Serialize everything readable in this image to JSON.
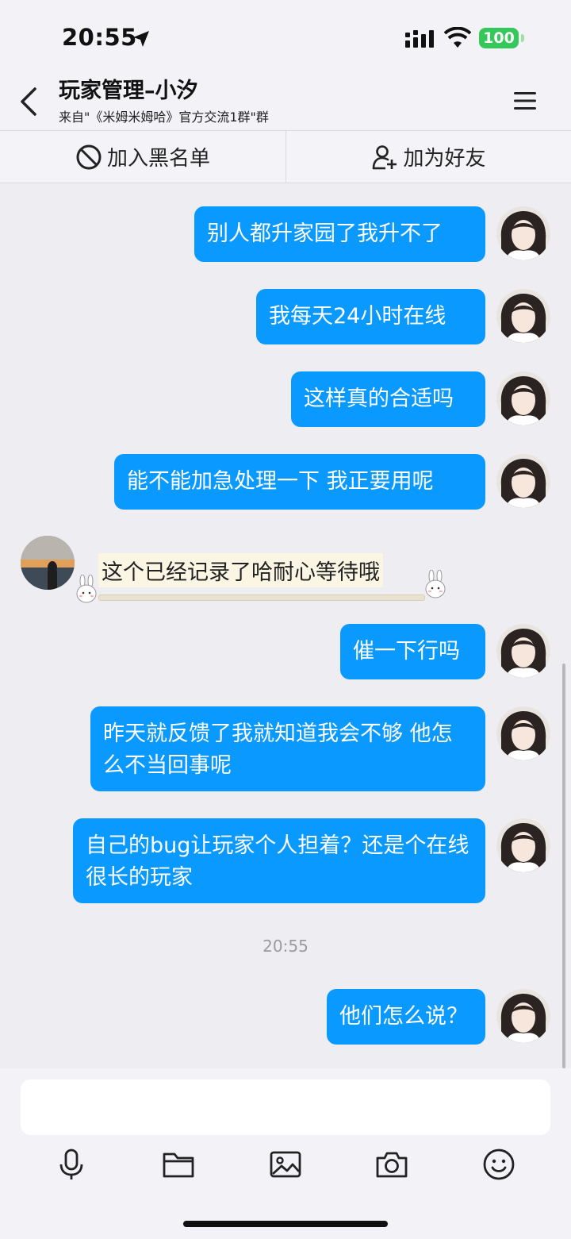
{
  "status_bar": {
    "time": "20:55",
    "battery": "100"
  },
  "header": {
    "title": "玩家管理–小汐",
    "subtitle": "来自\"《米姆米姆哈》官方交流1群\"群"
  },
  "actions": {
    "blacklist": "加入黑名单",
    "add_friend": "加为好友"
  },
  "messages": [
    {
      "from": "me",
      "text": "别人都升家园了我升不了"
    },
    {
      "from": "me",
      "text": "我每天24小时在线"
    },
    {
      "from": "me",
      "text": "这样真的合适吗"
    },
    {
      "from": "me",
      "text": "能不能加急处理一下 我正要用呢"
    },
    {
      "from": "other",
      "text": "这个已经记录了哈耐心等待哦"
    },
    {
      "from": "me",
      "text": "催一下行吗"
    },
    {
      "from": "me",
      "text": "昨天就反馈了我就知道我会不够 他怎么不当回事呢"
    },
    {
      "from": "me",
      "text": "自己的bug让玩家个人担着？还是个在线很长的玩家"
    },
    {
      "from": "me",
      "text": "他们怎么说？"
    }
  ],
  "timestamp": "20:55",
  "icons": [
    "location-arrow-icon",
    "signal-icon",
    "wifi-icon",
    "battery-icon",
    "back-chevron-icon",
    "menu-icon",
    "block-icon",
    "add-person-icon",
    "microphone-icon",
    "folder-icon",
    "image-icon",
    "camera-icon",
    "emoji-icon"
  ],
  "colors": {
    "bubble_out": "#0a99ff",
    "background": "#ededf2",
    "battery": "#34c759"
  }
}
